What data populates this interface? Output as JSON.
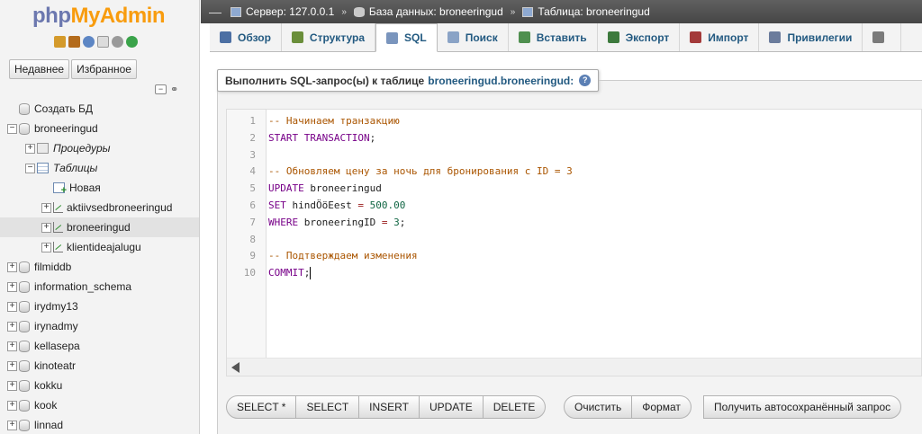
{
  "logo": {
    "part1": "php",
    "part2": "MyAdmin"
  },
  "nav": {
    "tabs": [
      "Недавнее",
      "Избранное"
    ],
    "tree": [
      {
        "label": "Создать БД",
        "icon": "new-db-icon",
        "level": 0,
        "expander": ""
      },
      {
        "label": "broneeringud",
        "icon": "database-icon",
        "level": 0,
        "expander": "−"
      },
      {
        "label": "Процедуры",
        "icon": "procedures-icon",
        "level": 1,
        "expander": "+",
        "italic": true
      },
      {
        "label": "Таблицы",
        "icon": "tables-icon",
        "level": 1,
        "expander": "−",
        "italic": true
      },
      {
        "label": "Новая",
        "icon": "new-table-icon",
        "level": 2,
        "expander": ""
      },
      {
        "label": "aktiivsedbroneeringud",
        "icon": "table-icon",
        "level": 2,
        "expander": "+"
      },
      {
        "label": "broneeringud",
        "icon": "table-icon",
        "level": 2,
        "expander": "+",
        "selected": true
      },
      {
        "label": "klientideajalugu",
        "icon": "table-icon",
        "level": 2,
        "expander": "+"
      },
      {
        "label": "filmiddb",
        "icon": "database-icon",
        "level": 0,
        "expander": "+"
      },
      {
        "label": "information_schema",
        "icon": "database-icon",
        "level": 0,
        "expander": "+"
      },
      {
        "label": "irydmy13",
        "icon": "database-icon",
        "level": 0,
        "expander": "+"
      },
      {
        "label": "irynadmy",
        "icon": "database-icon",
        "level": 0,
        "expander": "+"
      },
      {
        "label": "kellasepa",
        "icon": "database-icon",
        "level": 0,
        "expander": "+"
      },
      {
        "label": "kinoteatr",
        "icon": "database-icon",
        "level": 0,
        "expander": "+"
      },
      {
        "label": "kokku",
        "icon": "database-icon",
        "level": 0,
        "expander": "+"
      },
      {
        "label": "kook",
        "icon": "database-icon",
        "level": 0,
        "expander": "+"
      },
      {
        "label": "linnad",
        "icon": "database-icon",
        "level": 0,
        "expander": "+"
      }
    ]
  },
  "breadcrumb": {
    "server": "Сервер: 127.0.0.1",
    "database": "База данных: broneeringud",
    "table": "Таблица: broneeringud"
  },
  "tabs": [
    {
      "label": "Обзор",
      "icon": "browse-icon",
      "color": "#4c6fa3"
    },
    {
      "label": "Структура",
      "icon": "structure-icon",
      "color": "#6a8e3a"
    },
    {
      "label": "SQL",
      "icon": "sql-icon",
      "color": "#7a95bd",
      "active": true
    },
    {
      "label": "Поиск",
      "icon": "search-icon",
      "color": "#8aa3c6"
    },
    {
      "label": "Вставить",
      "icon": "insert-icon",
      "color": "#4f8f4f"
    },
    {
      "label": "Экспорт",
      "icon": "export-icon",
      "color": "#3d7a3d"
    },
    {
      "label": "Импорт",
      "icon": "import-icon",
      "color": "#a33a3a"
    },
    {
      "label": "Привилегии",
      "icon": "privileges-icon",
      "color": "#6b7c9c"
    },
    {
      "label": "",
      "icon": "operations-icon",
      "color": "#7a7a7a"
    }
  ],
  "query_box": {
    "legend_prefix": "Выполнить SQL-запрос(ы) к таблице",
    "legend_target": "broneeringud.broneeringud:",
    "code": [
      {
        "n": "1",
        "parts": [
          [
            "cm",
            "-- Начинаем транзакцию"
          ]
        ]
      },
      {
        "n": "2",
        "parts": [
          [
            "kw",
            "START TRANSACTION"
          ],
          [
            "",
            ";"
          ]
        ]
      },
      {
        "n": "3",
        "parts": []
      },
      {
        "n": "4",
        "parts": [
          [
            "cm",
            "-- Обновляем цену за ночь для бронирования с ID = 3"
          ]
        ]
      },
      {
        "n": "5",
        "parts": [
          [
            "kw",
            "UPDATE"
          ],
          [
            "",
            " broneeringud"
          ]
        ]
      },
      {
        "n": "6",
        "parts": [
          [
            "kw",
            "SET"
          ],
          [
            "",
            " hindÖöEest "
          ],
          [
            "op",
            "="
          ],
          [
            "",
            " "
          ],
          [
            "num",
            "500.00"
          ]
        ]
      },
      {
        "n": "7",
        "parts": [
          [
            "kw",
            "WHERE"
          ],
          [
            "",
            " broneeringID "
          ],
          [
            "op",
            "="
          ],
          [
            "",
            " "
          ],
          [
            "num",
            "3"
          ],
          [
            "",
            ";"
          ]
        ]
      },
      {
        "n": "8",
        "parts": []
      },
      {
        "n": "9",
        "parts": [
          [
            "cm",
            "-- Подтверждаем изменения"
          ]
        ]
      },
      {
        "n": "10",
        "parts": [
          [
            "kw",
            "COMMIT"
          ],
          [
            "",
            ";"
          ]
        ]
      }
    ]
  },
  "buttons": {
    "templates": [
      "SELECT *",
      "SELECT",
      "INSERT",
      "UPDATE",
      "DELETE"
    ],
    "clear": "Очистить",
    "format": "Формат",
    "autosave": "Получить автосохранённый запрос"
  }
}
